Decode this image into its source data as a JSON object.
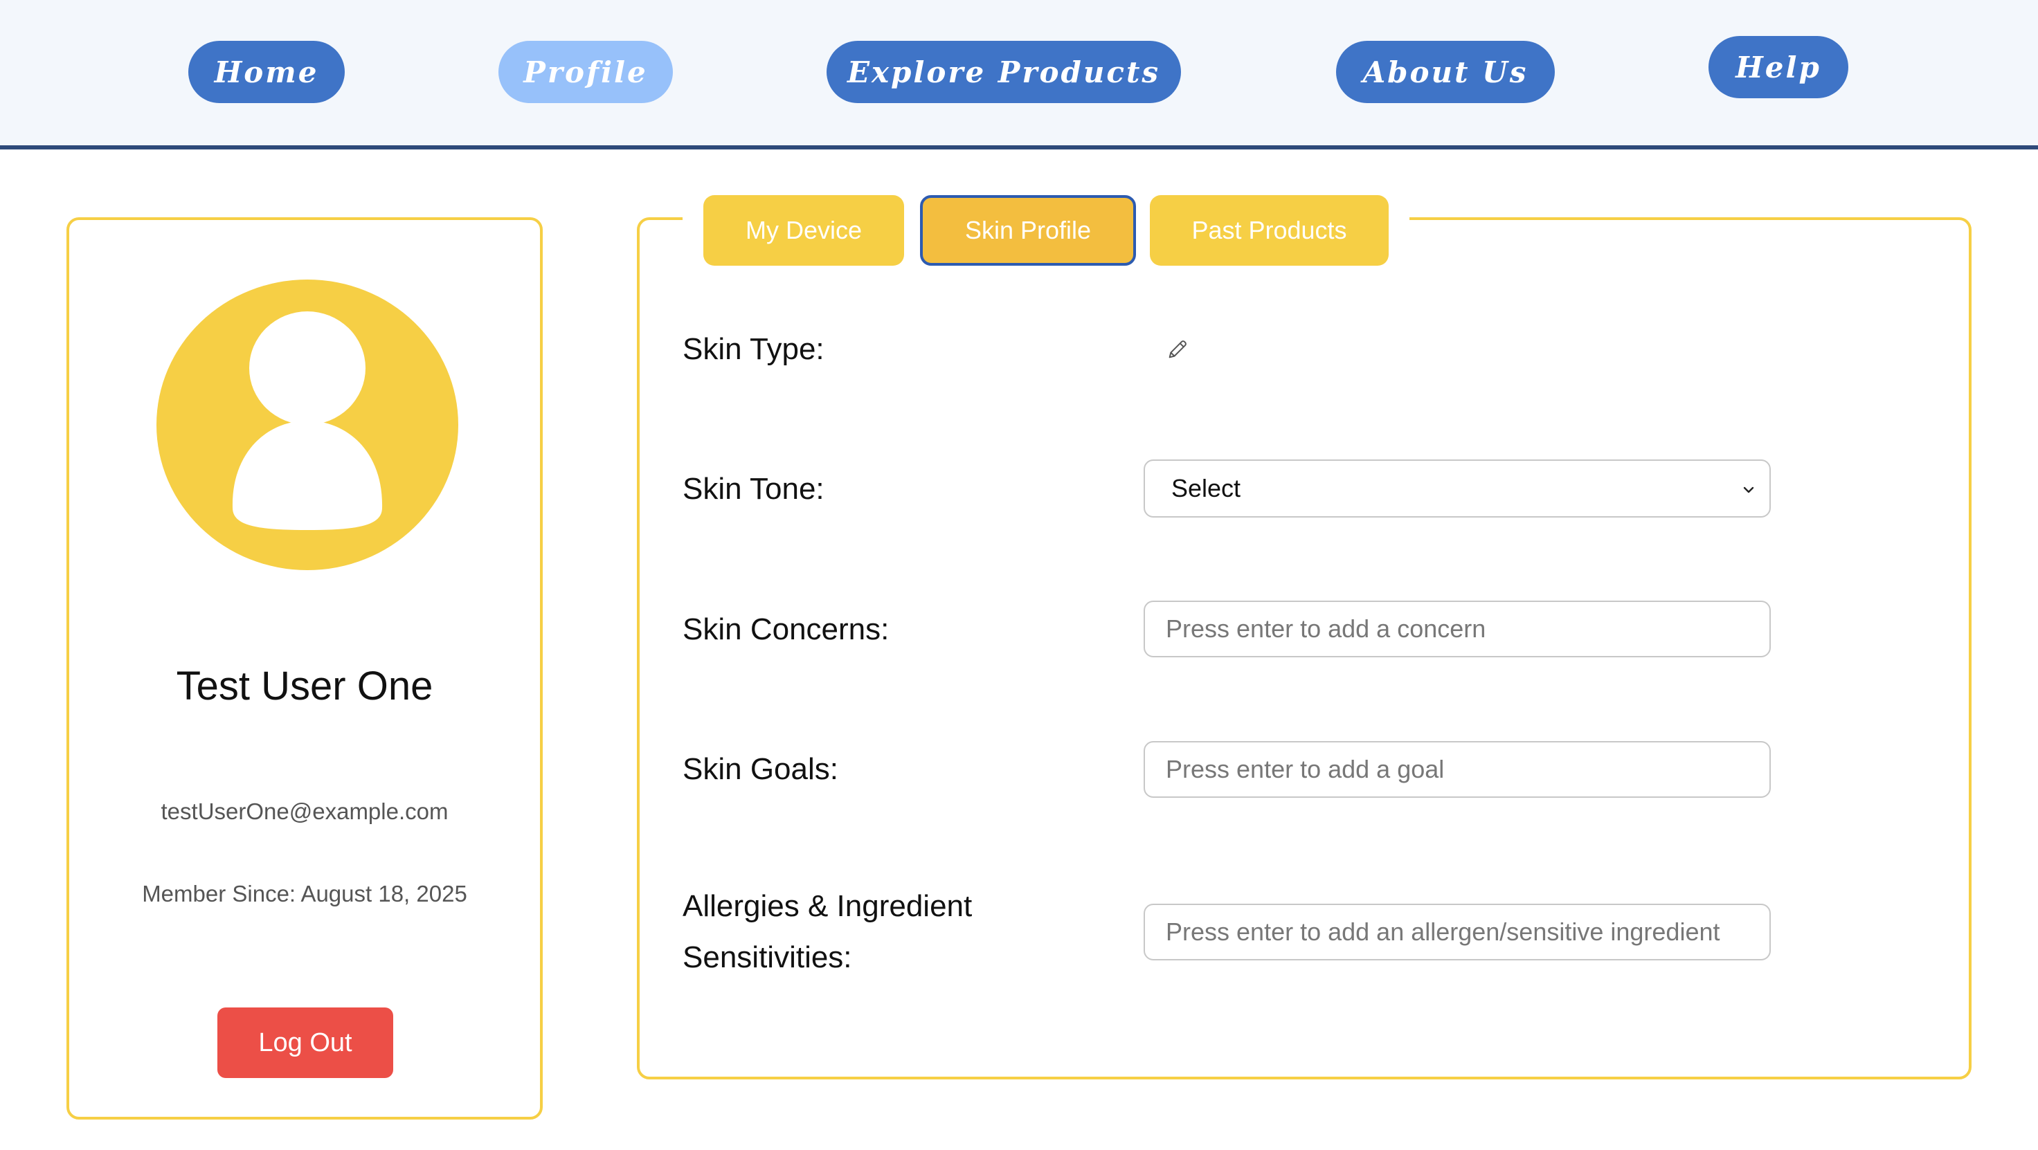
{
  "nav": {
    "home": "Home",
    "profile": "Profile",
    "explore": "Explore Products",
    "about": "About Us",
    "help": "Help"
  },
  "profile_card": {
    "name": "Test User One",
    "email": "testUserOne@example.com",
    "member_since": "Member Since: August 18, 2025",
    "logout_label": "Log Out"
  },
  "tabs": {
    "my_device": "My Device",
    "skin_profile": "Skin Profile",
    "past_products": "Past Products"
  },
  "form": {
    "skin_type_label": "Skin Type:",
    "skin_tone_label": "Skin Tone:",
    "skin_tone_value": "Select",
    "skin_concerns_label": "Skin Concerns:",
    "skin_concerns_placeholder": "Press enter to add a concern",
    "skin_goals_label": "Skin Goals:",
    "skin_goals_placeholder": "Press enter to add a goal",
    "allergies_label_line1": "Allergies & Ingredient",
    "allergies_label_line2": "Sensitivities:",
    "allergies_placeholder": "Press enter to add an allergen/sensitive ingredient"
  },
  "colors": {
    "nav_button": "#3f74c7",
    "nav_active": "#97c1fa",
    "accent_yellow": "#f6cf45",
    "logout_red": "#ec4f47"
  }
}
